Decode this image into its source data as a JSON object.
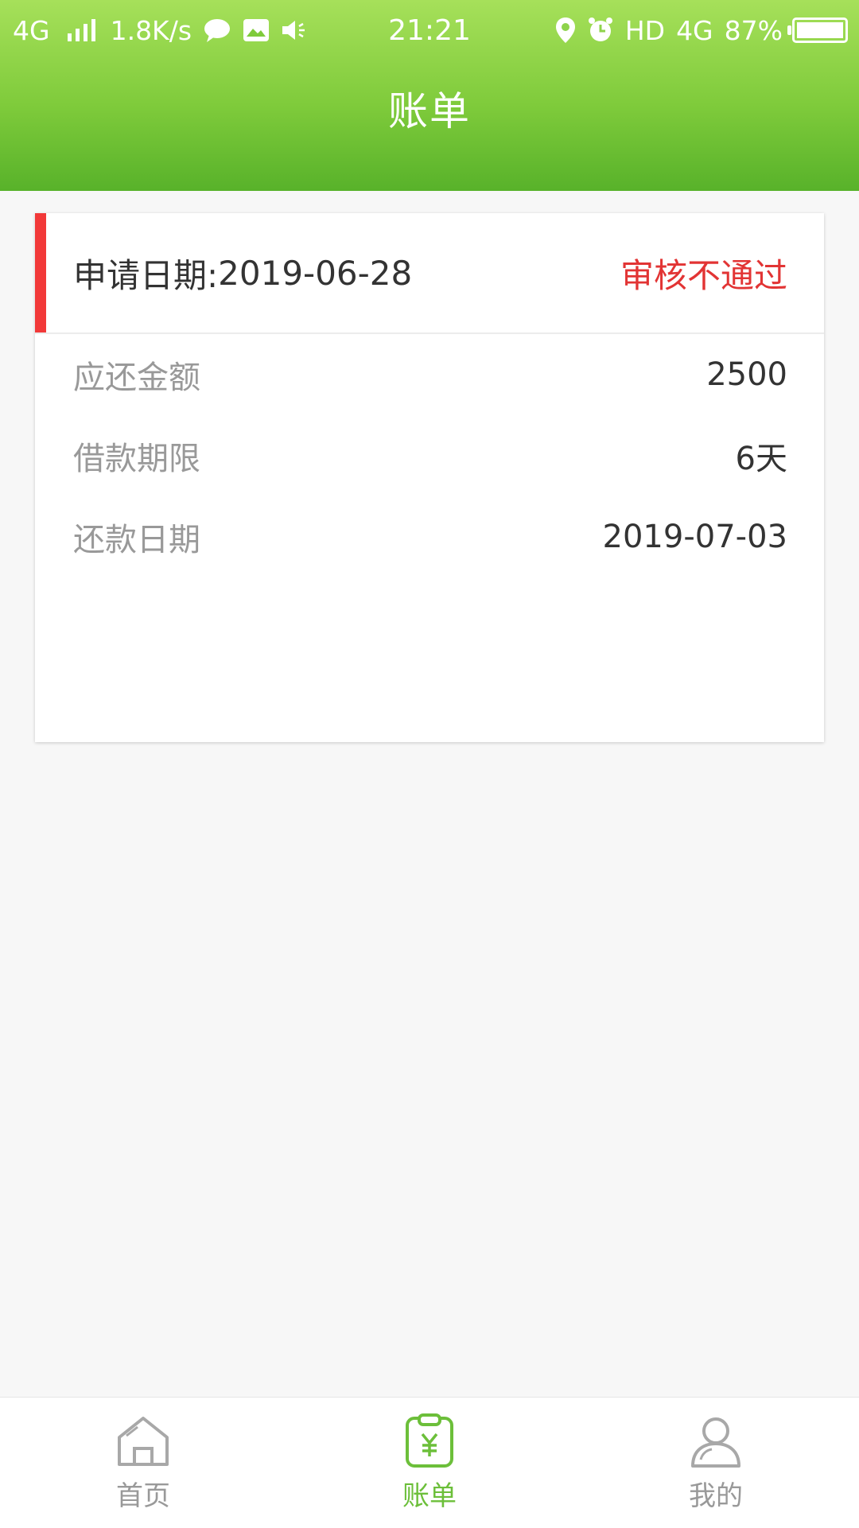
{
  "status_bar": {
    "network": "4G",
    "speed": "1.8K/s",
    "time": "21:21",
    "hd": "HD",
    "network2": "4G",
    "battery": "87%"
  },
  "header": {
    "title": "账单"
  },
  "bill": {
    "apply_label": "申请日期:",
    "apply_date": "2019-06-28",
    "status": "审核不通过",
    "rows": [
      {
        "label": "应还金额",
        "value": "2500"
      },
      {
        "label": "借款期限",
        "value": "6天"
      },
      {
        "label": "还款日期",
        "value": "2019-07-03"
      }
    ]
  },
  "tabbar": {
    "tabs": [
      {
        "label": "首页",
        "icon": "home-icon"
      },
      {
        "label": "账单",
        "icon": "bill-icon"
      },
      {
        "label": "我的",
        "icon": "user-icon"
      }
    ],
    "active": "账单"
  },
  "colors": {
    "header_top": "#a6e05a",
    "header_bottom": "#58b22a",
    "accent_red": "#f23939",
    "active_green": "#6cbf3a"
  }
}
